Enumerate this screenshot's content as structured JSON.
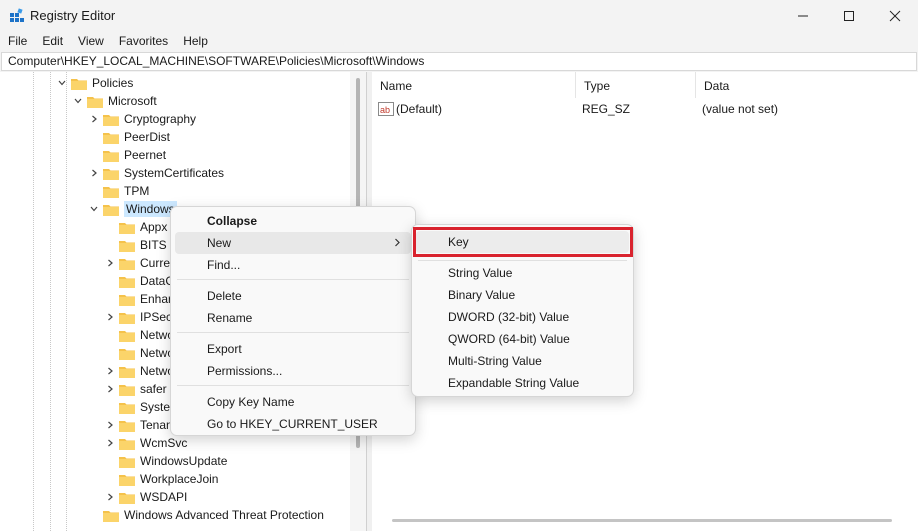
{
  "window": {
    "title": "Registry Editor",
    "icon": "registry-editor-icon",
    "controls": [
      "minimize-icon",
      "maximize-icon",
      "close-icon"
    ]
  },
  "menubar": [
    "File",
    "Edit",
    "View",
    "Favorites",
    "Help"
  ],
  "address": "Computer\\HKEY_LOCAL_MACHINE\\SOFTWARE\\Policies\\Microsoft\\Windows",
  "tree": {
    "policies": "Policies",
    "microsoft": "Microsoft",
    "cryptography": "Cryptography",
    "peerdist": "PeerDist",
    "peernet": "Peernet",
    "systemcertificates": "SystemCertificates",
    "tpm": "TPM",
    "windows": "Windows",
    "appx": "Appx",
    "bits": "BITS",
    "curre": "Curre",
    "datac": "DataC",
    "enhar": "Enhar",
    "ipsec": "IPSec",
    "netwo1": "Netwo",
    "netwo2": "Netwo",
    "netwo3": "Netwo",
    "safer": "safer",
    "syster": "Systen",
    "tenan": "Tenan",
    "wcmsvc": "WcmSvc",
    "windowsupdate": "WindowsUpdate",
    "workplacejoin": "WorkplaceJoin",
    "wsdapi": "WSDAPI",
    "watp": "Windows Advanced Threat Protection"
  },
  "list": {
    "columns": {
      "name": "Name",
      "type": "Type",
      "data": "Data"
    },
    "rows": [
      {
        "name": "(Default)",
        "type": "REG_SZ",
        "data": "(value not set)"
      }
    ]
  },
  "context_menu": {
    "collapse": "Collapse",
    "new": "New",
    "find": "Find...",
    "delete": "Delete",
    "rename": "Rename",
    "export": "Export",
    "permissions": "Permissions...",
    "copy_key_name": "Copy Key Name",
    "goto_hkcu": "Go to HKEY_CURRENT_USER"
  },
  "submenu": {
    "key": "Key",
    "string_value": "String Value",
    "binary_value": "Binary Value",
    "dword_value": "DWORD (32-bit) Value",
    "qword_value": "QWORD (64-bit) Value",
    "multi_string_value": "Multi-String Value",
    "expandable_string_value": "Expandable String Value"
  },
  "colors": {
    "highlight": "#d9232e",
    "folder": "#f5c24b",
    "selection": "#cce8ff"
  }
}
